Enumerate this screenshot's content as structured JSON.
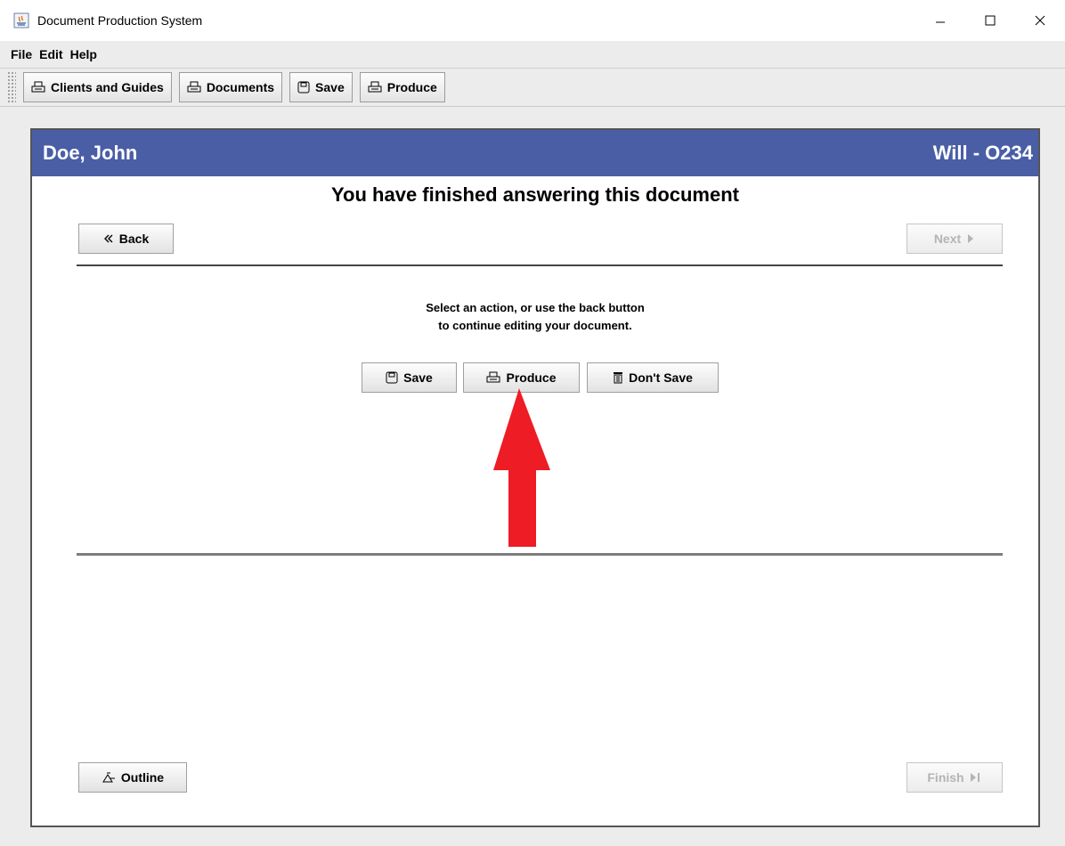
{
  "window": {
    "title": "Document Production System",
    "controls": [
      "minimize",
      "maximize",
      "close"
    ]
  },
  "menu": [
    "File",
    "Edit",
    "Help"
  ],
  "toolbar": {
    "clients_label": "Clients and Guides",
    "documents_label": "Documents",
    "save_label": "Save",
    "produce_label": "Produce"
  },
  "panel": {
    "client_name": "Doe, John",
    "document_id": "Will - O234",
    "heading": "You have finished answering this document",
    "back_label": "Back",
    "next_label": "Next",
    "instruction_line1": "Select an action, or use the back button",
    "instruction_line2": "to continue editing your document.",
    "actions": {
      "save_label": "Save",
      "produce_label": "Produce",
      "dont_save_label": "Don't Save"
    },
    "outline_label": "Outline",
    "finish_label": "Finish"
  },
  "colors": {
    "header_bg": "#4a5ea6",
    "arrow": "#ee1c25"
  }
}
